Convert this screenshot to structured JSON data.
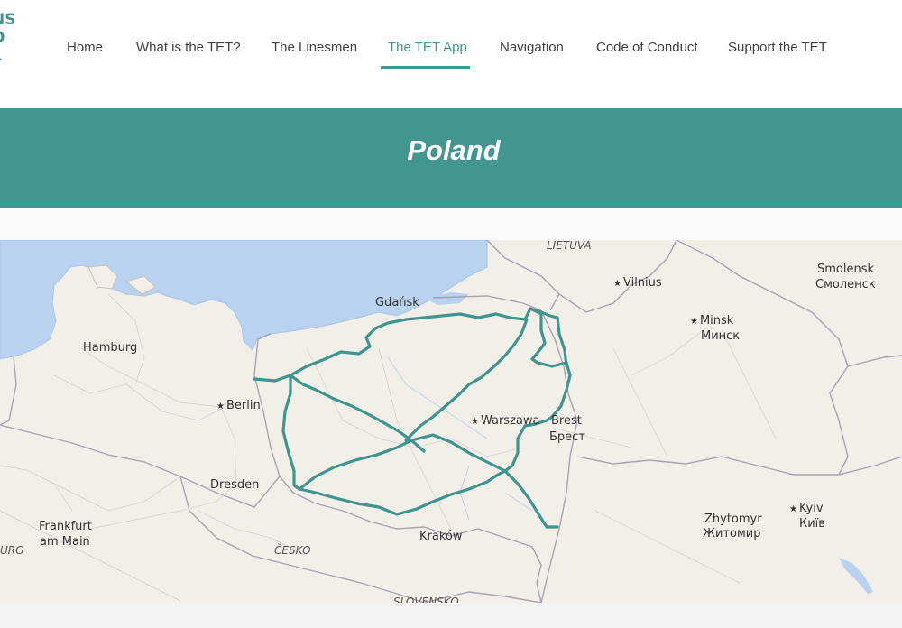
{
  "logo": {
    "lines": [
      "NS",
      "O",
      "L"
    ]
  },
  "nav": {
    "items": [
      {
        "label": "Home"
      },
      {
        "label": "What is the TET?"
      },
      {
        "label": "The Linesmen"
      },
      {
        "label": "The TET App",
        "active": true
      },
      {
        "label": "Navigation"
      },
      {
        "label": "Code of Conduct"
      },
      {
        "label": "Support the TET"
      }
    ]
  },
  "banner": {
    "title": "Poland"
  },
  "colors": {
    "accent": "#419691",
    "route": "#3e958f",
    "water": "#b8d2ef",
    "land": "#f2efe9"
  },
  "map": {
    "labels": {
      "lietuva": "LIETUVA",
      "vilnius": "Vilnius",
      "smolensk": "Smolensk",
      "smolensk_cyr": "Смоленск",
      "gdansk": "Gdańsk",
      "minsk": "Minsk",
      "minsk_cyr": "Минск",
      "hamburg": "Hamburg",
      "berlin": "Berlin",
      "warszawa": "Warszawa",
      "brest": "Brest",
      "brest_cyr": "Брест",
      "dresden": "Dresden",
      "frankfurt": "Frankfurt",
      "am_main": "am Main",
      "urg": "URG",
      "cesko": "ČESKO",
      "krakow": "Kraków",
      "zhytomyr": "Zhytomyr",
      "zhytomyr_cyr": "Житомир",
      "kyiv": "Kyiv",
      "kyiv_cyr": "Київ",
      "slovensko": "SLOVENSKO"
    }
  }
}
